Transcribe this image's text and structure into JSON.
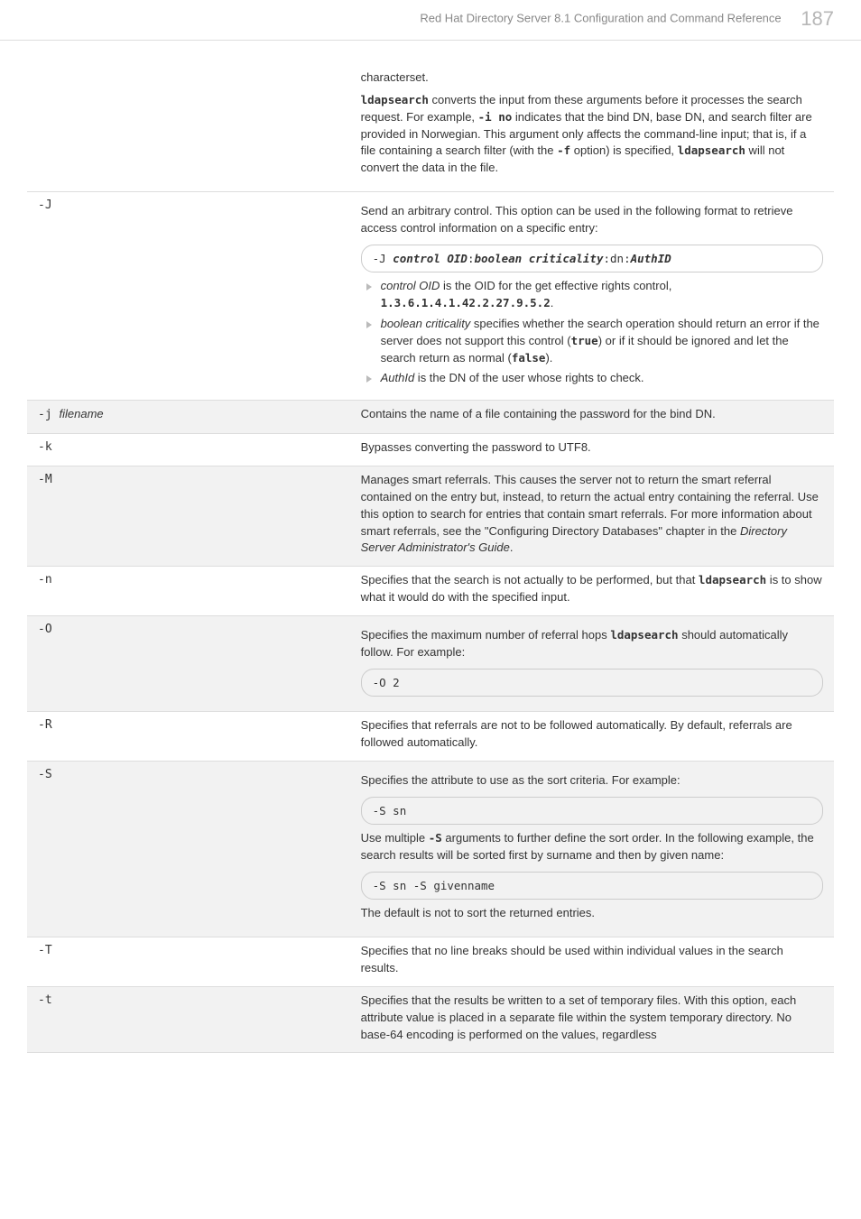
{
  "header": {
    "title": "Red Hat Directory Server 8.1 Configuration and Command Reference",
    "page": "187"
  },
  "rows": {
    "charset_cont": {
      "para0": "characterset.",
      "p_pre": "",
      "cmd1": "ldapsearch",
      "p_a": " converts the input from these arguments before it processes the search request. For example, ",
      "opt1": "-i no",
      "p_b": " indicates that the bind DN, base DN, and search filter are provided in Norwegian. This argument only affects the command-line input; that is, if a file containing a search filter (with the ",
      "opt2": "-f",
      "p_c": " option) is specified, ",
      "cmd2": "ldapsearch",
      "p_d": " will not convert the data in the file."
    },
    "J": {
      "opt": "-J",
      "intro": "Send an arbitrary control. This option can be used in the following format to retrieve access control information on a specific entry:",
      "code_prefix": "-J ",
      "code_oid": "control OID",
      "code_sep1": ":",
      "code_bool": "boolean criticality",
      "code_sep2": ":dn:",
      "code_auth": "AuthID",
      "li1_a": "control OID",
      "li1_b": " is the OID for the get effective rights control, ",
      "li1_oid": "1.3.6.1.4.1.42.2.27.9.5.2",
      "li1_dot": ".",
      "li2_a": "boolean criticality",
      "li2_b": " specifies whether the search operation should return an error if the server does not support this control (",
      "li2_true": "true",
      "li2_c": ") or if it should be ignored and let the search return as normal (",
      "li2_false": "false",
      "li2_d": ").",
      "li3_a": "AuthId",
      "li3_b": " is the DN of the user whose rights to check."
    },
    "j": {
      "opt": "-j ",
      "opt_ital": "filename",
      "desc": "Contains the name of a file containing the password for the bind DN."
    },
    "k": {
      "opt": "-k",
      "desc": "Bypasses converting the password to UTF8."
    },
    "M": {
      "opt": "-M",
      "desc_a": "Manages smart referrals. This causes the server not to return the smart referral contained on the entry but, instead, to return the actual entry containing the referral. Use this option to search for entries that contain smart referrals. For more information about smart referrals, see the \"Configuring Directory Databases\" chapter in the ",
      "desc_ital": "Directory Server Administrator's Guide",
      "desc_b": "."
    },
    "n": {
      "opt": "-n",
      "desc_a": "Specifies that the search is not actually to be performed, but that ",
      "cmd": "ldapsearch",
      "desc_b": " is to show what it would do with the specified input."
    },
    "O": {
      "opt": "-O",
      "desc_a": "Specifies the maximum number of referral hops ",
      "cmd": "ldapsearch",
      "desc_b": " should automatically follow. For example:",
      "code": "-O 2"
    },
    "R": {
      "opt": "-R",
      "desc": "Specifies that referrals are not to be followed automatically. By default, referrals are followed automatically."
    },
    "S": {
      "opt": "-S",
      "desc1": "Specifies the attribute to use as the sort criteria. For example:",
      "code1": "-S sn",
      "desc2_a": "Use multiple ",
      "opt_inner": "-S",
      "desc2_b": " arguments to further define the sort order. In the following example, the search results will be sorted first by surname and then by given name:",
      "code2": "-S sn -S givenname",
      "desc3": "The default is not to sort the returned entries."
    },
    "T": {
      "opt": "-T",
      "desc": "Specifies that no line breaks should be used within individual values in the search results."
    },
    "t": {
      "opt": "-t",
      "desc": "Specifies that the results be written to a set of temporary files. With this option, each attribute value is placed in a separate file within the system temporary directory. No base-64 encoding is performed on the values, regardless"
    }
  }
}
